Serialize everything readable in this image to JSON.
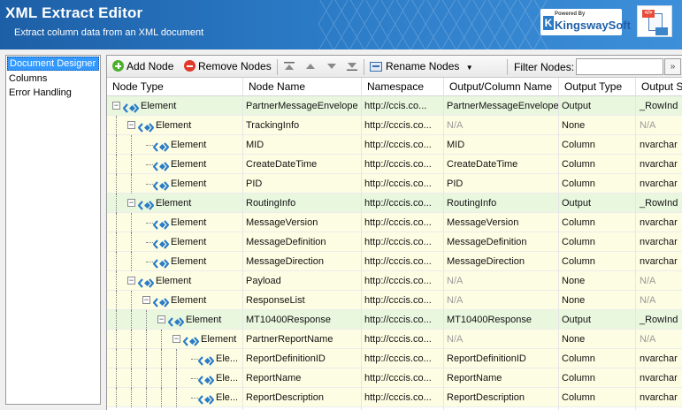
{
  "window": {
    "title": "XML Extract Editor",
    "subtitle": "Extract column data from an XML document",
    "logo_powered_by": "Powered By",
    "logo_brand": "KingswaySoft"
  },
  "nav": {
    "items": [
      {
        "label": "Document Designer",
        "selected": true
      },
      {
        "label": "Columns",
        "selected": false
      },
      {
        "label": "Error Handling",
        "selected": false
      }
    ]
  },
  "toolbar": {
    "add_label": "Add Node",
    "remove_label": "Remove Nodes",
    "rename_label": "Rename Nodes",
    "filter_label": "Filter Nodes:",
    "filter_value": "",
    "filter_go": "»"
  },
  "grid": {
    "columns": [
      "Node Type",
      "Node Name",
      "Namespace",
      "Output/Column Name",
      "Output Type",
      "Output S"
    ],
    "rows": [
      {
        "level": 0,
        "type": "Element",
        "name": "PartnerMessageEnvelope",
        "ns": "http://ccis.co...",
        "out": "PartnerMessageEnvelope",
        "otype": "Output",
        "os": "_RowInd",
        "hl": "green",
        "expander": "-"
      },
      {
        "level": 1,
        "type": "Element",
        "name": "TrackingInfo",
        "ns": "http://cccis.co...",
        "out": "N/A",
        "otype": "None",
        "os": "N/A",
        "hl": "yellow",
        "expander": "-"
      },
      {
        "level": 2,
        "type": "Element",
        "name": "MID",
        "ns": "http://cccis.co...",
        "out": "MID",
        "otype": "Column",
        "os": "nvarchar",
        "hl": "yellow",
        "expander": ""
      },
      {
        "level": 2,
        "type": "Element",
        "name": "CreateDateTime",
        "ns": "http://cccis.co...",
        "out": "CreateDateTime",
        "otype": "Column",
        "os": "nvarchar",
        "hl": "yellow",
        "expander": ""
      },
      {
        "level": 2,
        "type": "Element",
        "name": "PID",
        "ns": "http://cccis.co...",
        "out": "PID",
        "otype": "Column",
        "os": "nvarchar",
        "hl": "yellow",
        "expander": ""
      },
      {
        "level": 1,
        "type": "Element",
        "name": "RoutingInfo",
        "ns": "http://cccis.co...",
        "out": "RoutingInfo",
        "otype": "Output",
        "os": "_RowInd",
        "hl": "green",
        "expander": "-"
      },
      {
        "level": 2,
        "type": "Element",
        "name": "MessageVersion",
        "ns": "http://cccis.co...",
        "out": "MessageVersion",
        "otype": "Column",
        "os": "nvarchar",
        "hl": "yellow",
        "expander": ""
      },
      {
        "level": 2,
        "type": "Element",
        "name": "MessageDefinition",
        "ns": "http://cccis.co...",
        "out": "MessageDefinition",
        "otype": "Column",
        "os": "nvarchar",
        "hl": "yellow",
        "expander": ""
      },
      {
        "level": 2,
        "type": "Element",
        "name": "MessageDirection",
        "ns": "http://cccis.co...",
        "out": "MessageDirection",
        "otype": "Column",
        "os": "nvarchar",
        "hl": "yellow",
        "expander": ""
      },
      {
        "level": 1,
        "type": "Element",
        "name": "Payload",
        "ns": "http://cccis.co...",
        "out": "N/A",
        "otype": "None",
        "os": "N/A",
        "hl": "yellow",
        "expander": "-"
      },
      {
        "level": 2,
        "type": "Element",
        "name": "ResponseList",
        "ns": "http://cccis.co...",
        "out": "N/A",
        "otype": "None",
        "os": "N/A",
        "hl": "yellow",
        "expander": "-"
      },
      {
        "level": 3,
        "type": "Element",
        "name": "MT10400Response",
        "ns": "http://cccis.co...",
        "out": "MT10400Response",
        "otype": "Output",
        "os": "_RowInd",
        "hl": "green",
        "expander": "-"
      },
      {
        "level": 4,
        "type": "Element",
        "name": "PartnerReportName",
        "ns": "http://cccis.co...",
        "out": "N/A",
        "otype": "None",
        "os": "N/A",
        "hl": "yellow",
        "expander": "-"
      },
      {
        "level": 5,
        "type": "Ele...",
        "name": "ReportDefinitionID",
        "ns": "http://cccis.co...",
        "out": "ReportDefinitionID",
        "otype": "Column",
        "os": "nvarchar",
        "hl": "yellow",
        "expander": ""
      },
      {
        "level": 5,
        "type": "Ele...",
        "name": "ReportName",
        "ns": "http://cccis.co...",
        "out": "ReportName",
        "otype": "Column",
        "os": "nvarchar",
        "hl": "yellow",
        "expander": ""
      },
      {
        "level": 5,
        "type": "Ele...",
        "name": "ReportDescription",
        "ns": "http://cccis.co...",
        "out": "ReportDescription",
        "otype": "Column",
        "os": "nvarchar",
        "hl": "yellow",
        "expander": ""
      }
    ]
  },
  "colors": {
    "header_start": "#1d5fa6",
    "header_end": "#3d8fd9",
    "row_output": "#e9f7df",
    "row_other": "#fdfde3",
    "nav_selected": "#3399ff",
    "node_icon": "#2a7cc7"
  }
}
